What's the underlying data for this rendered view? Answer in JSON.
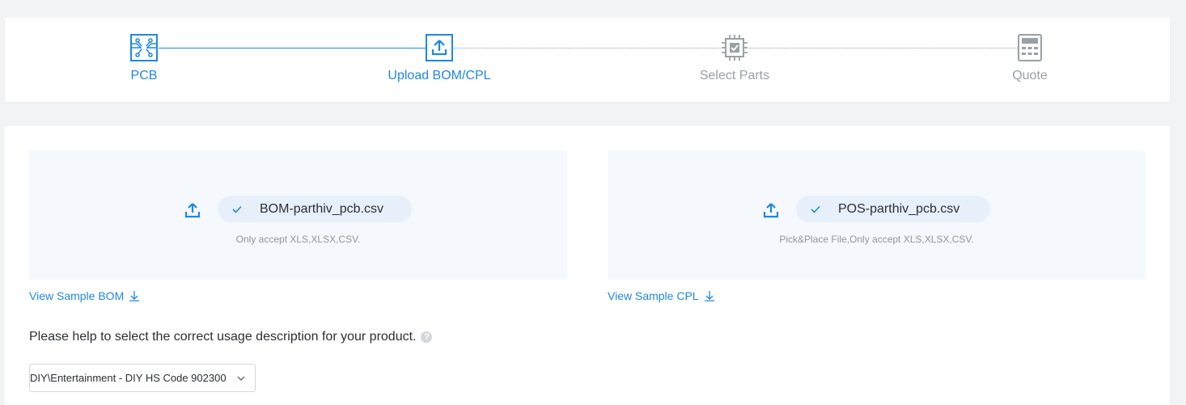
{
  "stepper": {
    "steps": [
      {
        "label": "PCB",
        "icon": "pcb-circuit-icon",
        "state": "done"
      },
      {
        "label": "Upload BOM/CPL",
        "icon": "upload-icon",
        "state": "active"
      },
      {
        "label": "Select Parts",
        "icon": "chip-check-icon",
        "state": "pending"
      },
      {
        "label": "Quote",
        "icon": "calculator-icon",
        "state": "pending"
      }
    ],
    "colors": {
      "active": "#1e88e5",
      "pending": "#9aa0a6"
    }
  },
  "bom_upload": {
    "file_name": "BOM-parthiv_pcb.csv",
    "accept_text": "Only accept XLS,XLSX,CSV.",
    "sample_link": "View Sample BOM"
  },
  "cpl_upload": {
    "file_name": "POS-parthiv_pcb.csv",
    "accept_text": "Pick&Place File,Only accept XLS,XLSX,CSV.",
    "sample_link": "View Sample CPL"
  },
  "usage": {
    "question": "Please help to select the correct usage description for your product.",
    "selected_value": "DIY\\Entertainment - DIY  HS Code 902300"
  }
}
